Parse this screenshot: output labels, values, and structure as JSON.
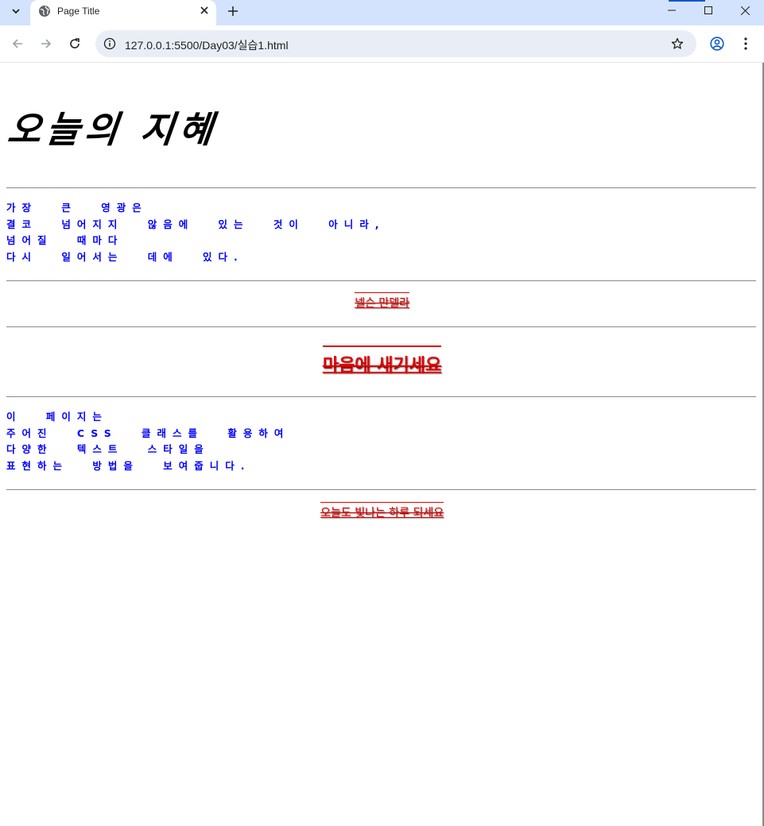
{
  "browser": {
    "tab_title": "Page Title",
    "url": "127.0.0.1:5500/Day03/실습1.html"
  },
  "page": {
    "heading": "오늘의 지혜",
    "quote_lines": [
      "가장 큰 영광은",
      "결코 넘어지지 않음에 있는 것이 아니라,",
      "넘어질 때마다",
      "다시 일어서는 데에 있다."
    ],
    "author": "넬슨 만델라",
    "emphasis": "마음에 새기세요",
    "description_lines": [
      "이 페이지는",
      "주어진 CSS 클래스를 활용하여",
      "다양한 텍스트 스타일을",
      "표현하는 방법을 보여줍니다."
    ],
    "closing": "오늘도 빛나는 하루 되세요"
  },
  "colors": {
    "tabstrip": "#d3e3fd",
    "omnibox": "#e9eef6",
    "text_blue": "#0000ff",
    "text_red": "#e00000",
    "rule": "#8a8a8a"
  },
  "icons": [
    "tab-search-icon",
    "globe-icon",
    "close-icon",
    "plus-icon",
    "minimize-icon",
    "maximize-icon",
    "window-close-icon",
    "back-arrow-icon",
    "forward-arrow-icon",
    "reload-icon",
    "info-icon",
    "star-icon",
    "profile-icon",
    "kebab-menu-icon"
  ]
}
